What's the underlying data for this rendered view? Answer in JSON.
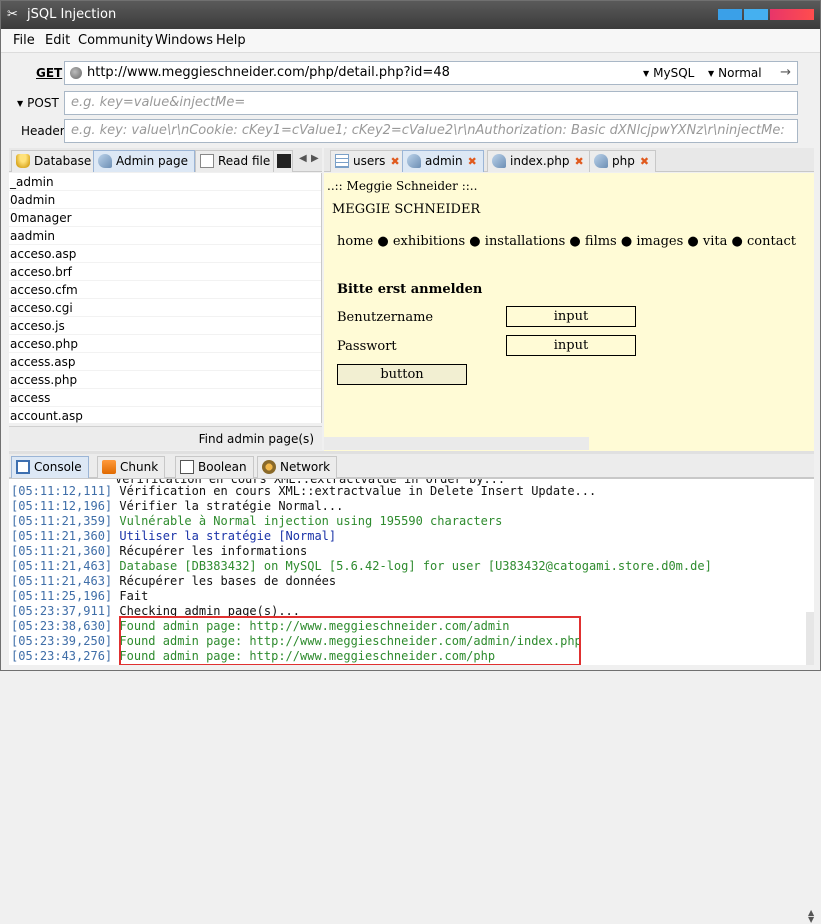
{
  "window": {
    "title": "jSQL Injection"
  },
  "menu": [
    "File",
    "Edit",
    "Community",
    "Windows",
    "Help"
  ],
  "request": {
    "get_label": "GET",
    "url": "http://www.meggieschneider.com/php/detail.php?id=48",
    "db_vendor": "MySQL",
    "strategy": "Normal",
    "post_label": "POST",
    "post_placeholder": "e.g. key=value&injectMe=",
    "header_label": "Header",
    "header_placeholder": "e.g. key: value\\r\\nCookie: cKey1=cValue1; cKey2=cValue2\\r\\nAuthorization: Basic dXNlcjpwYXNz\\r\\ninjectMe:"
  },
  "left_tabs": [
    "Database",
    "Admin page",
    "Read file"
  ],
  "result_tabs": [
    "users",
    "admin",
    "index.php",
    "php"
  ],
  "admin_list": [
    "_admin",
    "0admin",
    "0manager",
    "aadmin",
    "acceso.asp",
    "acceso.brf",
    "acceso.cfm",
    "acceso.cgi",
    "acceso.js",
    "acceso.php",
    "access.asp",
    "access.php",
    "access",
    "account.asp"
  ],
  "find_button": "Find admin page(s)",
  "preview": {
    "page_title": "..:: Meggie Schneider ::..",
    "heading": "MEGGIE SCHNEIDER",
    "nav": [
      "home",
      "exhibitions",
      "installations",
      "films",
      "images",
      "vita",
      "contact"
    ],
    "bullet": "●",
    "login_title": "Bitte erst anmelden",
    "user_label": "Benutzername",
    "pass_label": "Passwort",
    "input_text": "input",
    "button_text": "button"
  },
  "bottom_tabs": [
    "Console",
    "Chunk",
    "Boolean",
    "Network"
  ],
  "console": [
    {
      "ts": "",
      "msg": "Vérification en cours XML::extractvalue in Order by...",
      "color": "black"
    },
    {
      "ts": "[05:11:12,111]",
      "msg": "Vérification en cours XML::extractvalue in Delete Insert Update...",
      "color": "black"
    },
    {
      "ts": "[05:11:12,196]",
      "msg": "Vérifier la stratégie Normal...",
      "color": "black"
    },
    {
      "ts": "[05:11:21,359]",
      "msg": "Vulnérable à Normal injection using 195590 characters",
      "color": "green"
    },
    {
      "ts": "[05:11:21,360]",
      "msg": "Utiliser la stratégie [Normal]",
      "color": "blue"
    },
    {
      "ts": "[05:11:21,360]",
      "msg": "Récupérer les informations",
      "color": "black"
    },
    {
      "ts": "[05:11:21,463]",
      "msg": "Database [DB383432] on MySQL [5.6.42-log] for user [U383432@catogami.store.d0m.de]",
      "color": "green"
    },
    {
      "ts": "[05:11:21,463]",
      "msg": "Récupérer les bases de données",
      "color": "black"
    },
    {
      "ts": "[05:11:25,196]",
      "msg": "Fait",
      "color": "black"
    },
    {
      "ts": "[05:23:37,911]",
      "msg": "Checking admin page(s)...",
      "color": "black"
    },
    {
      "ts": "[05:23:38,630]",
      "msg": "Found admin page: http://www.meggieschneider.com/admin",
      "color": "green"
    },
    {
      "ts": "[05:23:39,250]",
      "msg": "Found admin page: http://www.meggieschneider.com/admin/index.php",
      "color": "green"
    },
    {
      "ts": "[05:23:43,276]",
      "msg": "Found admin page: http://www.meggieschneider.com/php",
      "color": "green"
    }
  ]
}
